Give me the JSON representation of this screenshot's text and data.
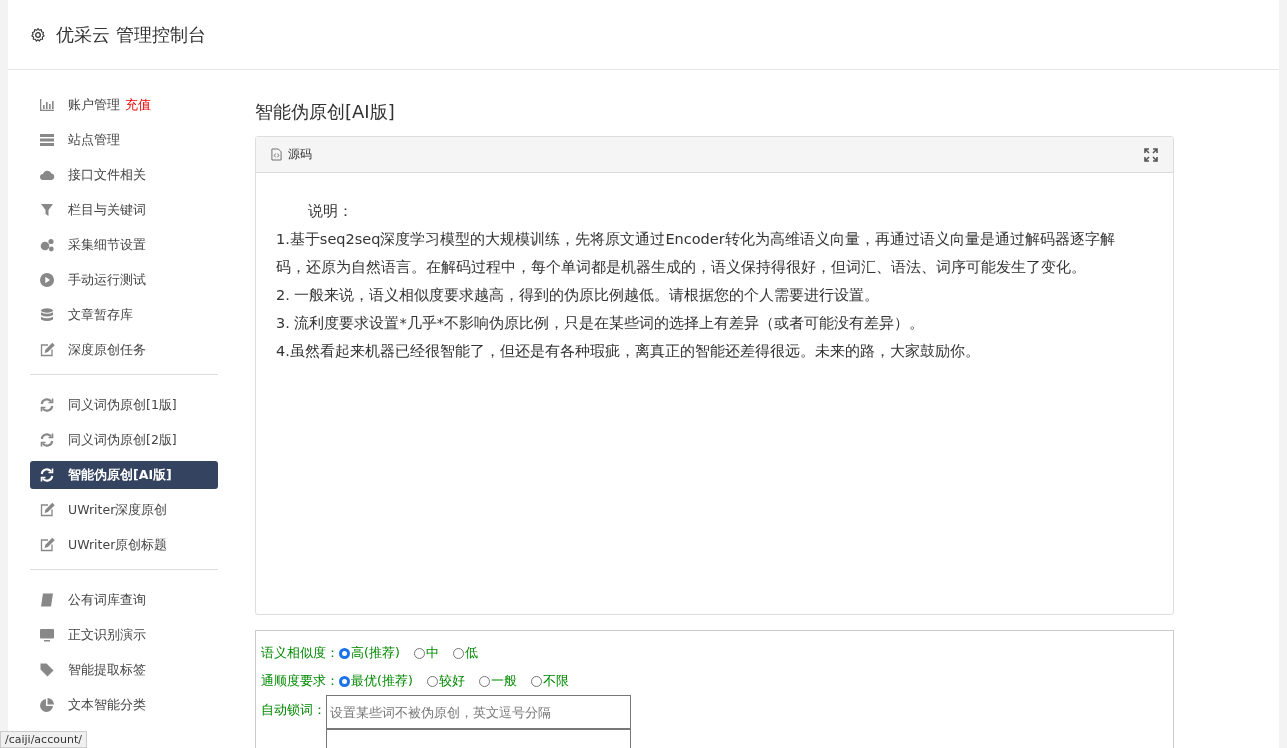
{
  "header": {
    "title": "优采云 管理控制台"
  },
  "sidebar": {
    "groups": [
      {
        "items": [
          {
            "label": "账户管理",
            "badge": "充值",
            "selected": false
          },
          {
            "label": "站点管理",
            "selected": false
          },
          {
            "label": "接口文件相关",
            "selected": false
          },
          {
            "label": "栏目与关键词",
            "selected": false
          },
          {
            "label": "采集细节设置",
            "selected": false
          },
          {
            "label": "手动运行测试",
            "selected": false
          },
          {
            "label": "文章暂存库",
            "selected": false
          },
          {
            "label": "深度原创任务",
            "selected": false
          }
        ]
      },
      {
        "items": [
          {
            "label": "同义词伪原创[1版]",
            "selected": false
          },
          {
            "label": "同义词伪原创[2版]",
            "selected": false
          },
          {
            "label": "智能伪原创[AI版]",
            "selected": true
          },
          {
            "label": "UWriter深度原创",
            "selected": false
          },
          {
            "label": "UWriter原创标题",
            "selected": false
          }
        ]
      },
      {
        "items": [
          {
            "label": "公有词库查询",
            "selected": false
          },
          {
            "label": "正文识别演示",
            "selected": false
          },
          {
            "label": "智能提取标签",
            "selected": false
          },
          {
            "label": "文本智能分类",
            "selected": false
          }
        ]
      }
    ]
  },
  "page_title": "智能伪原创[AI版]",
  "editor": {
    "toolbar_label": "源码",
    "heading": "说明：",
    "paragraphs": [
      "1.基于seq2seq深度学习模型的大规模训练，先将原文通过Encoder转化为高维语义向量，再通过语义向量是通过解码器逐字解码，还原为自然语言。在解码过程中，每个单词都是机器生成的，语义保持得很好，但词汇、语法、词序可能发生了变化。",
      "2. 一般来说，语义相似度要求越高，得到的伪原比例越低。请根据您的个人需要进行设置。",
      "3. 流利度要求设置*几乎*不影响伪原比例，只是在某些词的选择上有差异（或者可能没有差异）。",
      "4.虽然看起来机器已经很智能了，但还是有各种瑕疵，离真正的智能还差得很远。未来的路，大家鼓励你。"
    ]
  },
  "options": {
    "similarity": {
      "label": "语义相似度：",
      "choices": [
        {
          "label": "高(推荐)",
          "selected": true
        },
        {
          "label": "中",
          "selected": false
        },
        {
          "label": "低",
          "selected": false
        }
      ]
    },
    "fluency": {
      "label": "通顺度要求：",
      "choices": [
        {
          "label": "最优(推荐)",
          "selected": true
        },
        {
          "label": "较好",
          "selected": false
        },
        {
          "label": "一般",
          "selected": false
        },
        {
          "label": "不限",
          "selected": false
        }
      ]
    },
    "lock_words": {
      "label": "自动锁词：",
      "placeholder": "设置某些词不被伪原创，英文逗号分隔"
    }
  },
  "status_link": "/caiji/account/"
}
